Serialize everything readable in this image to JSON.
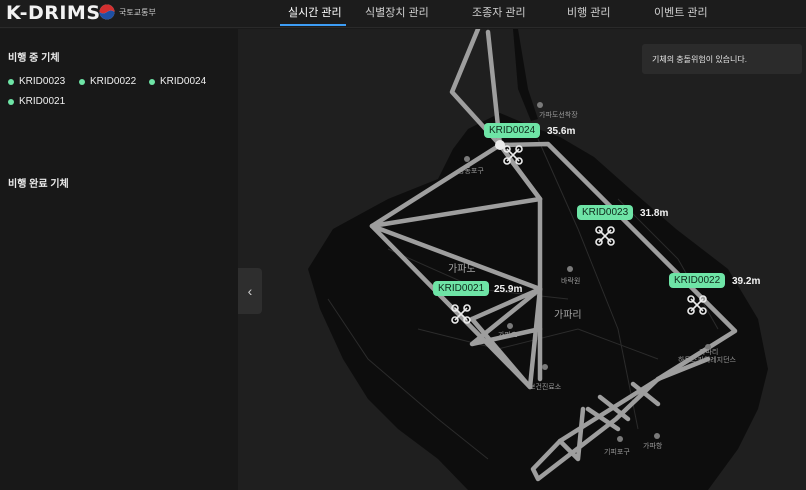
{
  "header": {
    "brand": "K-DRIMS",
    "ministry": "국토교통부",
    "nav": [
      {
        "label": "실시간 관리",
        "active": true
      },
      {
        "label": "식별장치 관리",
        "active": false
      },
      {
        "label": "조종자 관리",
        "active": false
      },
      {
        "label": "비행 관리",
        "active": false
      },
      {
        "label": "이벤트 관리",
        "active": false
      }
    ]
  },
  "sidebar": {
    "flying_title": "비행 중 기체",
    "flying": [
      "KRID0023",
      "KRID0022",
      "KRID0024",
      "KRID0021"
    ],
    "completed_title": "비행 완료 기체",
    "collapse_icon": "chevron-left-icon"
  },
  "map": {
    "toast": "기체의 충돌위험이 있습니다.",
    "drones": [
      {
        "id": "KRID0024",
        "altitude": "35.6m"
      },
      {
        "id": "KRID0023",
        "altitude": "31.8m"
      },
      {
        "id": "KRID0022",
        "altitude": "39.2m"
      },
      {
        "id": "KRID0021",
        "altitude": "25.9m"
      }
    ],
    "labels": {
      "place1": "가파도선착장",
      "place2": "상동포구",
      "place3": "가파도",
      "place4": "가파리",
      "place5": "바락원",
      "place6": "보건진료소",
      "place7": "가파초",
      "place8": "가파리",
      "place9": "하트스카이레지던스",
      "place10": "가파항",
      "place11": "기피포구"
    },
    "colors": {
      "route": "#a0a0a0",
      "tag": "#6ee4a6",
      "land": "#0d0d0d",
      "sea": "#1f1f1f"
    }
  }
}
